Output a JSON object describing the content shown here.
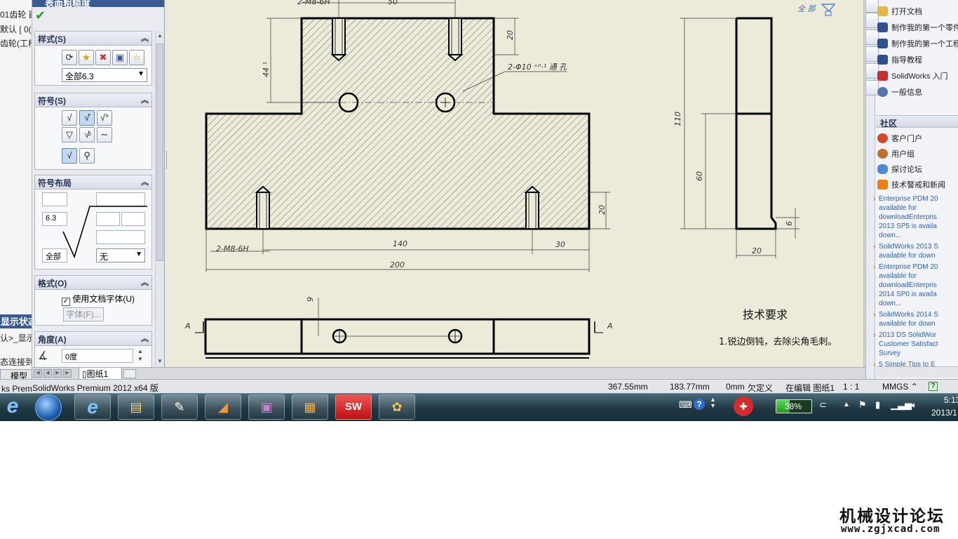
{
  "colors": {
    "accent": "#3a5a96",
    "sheet": "#ecebd9",
    "taskbar": "#1f3743",
    "link": "#2f63b6",
    "ok": "#2c9a2c"
  },
  "tree": {
    "rows": [
      "01齿轮 酉",
      "默认 [ 0(",
      "齿轮(工柄"
    ],
    "header": "显示状态",
    "rows2": [
      "认>_显示",
      "态连接到"
    ],
    "model_tab": "模型",
    "bottom_frag": "ks Premi"
  },
  "pm": {
    "title": "表面粗糙度",
    "groups": {
      "style": {
        "title": "样式(S)",
        "preset": "全部6.3"
      },
      "symbol": {
        "title": "符号(S)"
      },
      "layout": {
        "title": "符号布局",
        "value": "6.3",
        "all_label": "全部",
        "none_option": "无"
      },
      "format": {
        "title": "格式(O)",
        "use_doc_font": "使用文档字体(U)",
        "font_btn": "字体(F)..."
      },
      "angle": {
        "title": "角度(A)",
        "value": "0度"
      }
    }
  },
  "drawing": {
    "view_label": "全 部",
    "dims": {
      "top_thread": "2-M8-6H",
      "top_50": "50",
      "h20_top": "20",
      "h44": "44 ¹",
      "hole_note": "2-Φ10 ⁺⁰·¹ 通 孔",
      "h20_bot": "20",
      "bot_thread": "2-M8-6H",
      "w140": "140",
      "w30": "30",
      "w200": "200",
      "h110": "110",
      "h60": "60",
      "h6": "6",
      "w20": "20",
      "dim9": "9",
      "sec_a": "A"
    },
    "tech_title": "技术要求",
    "tech_item": "1.锐边倒钝，去除尖角毛刺。"
  },
  "sheet_tab": "图纸1",
  "status": {
    "product": "SolidWorks Premium 2012 x64 版",
    "x": "367.55mm",
    "y": "183.77mm",
    "z": "0mm",
    "defined": "欠定义",
    "editing": "在编辑 图纸1",
    "scale": "1 : 1",
    "units": "MMGS ⌃",
    "help": "?"
  },
  "task_pane": {
    "links": [
      {
        "label": "打开文档",
        "icon": "folder-icon",
        "color": "#e8b640"
      },
      {
        "label": "制作我的第一个零件",
        "icon": "graduation-cap-icon",
        "color": "#2f4f8f"
      },
      {
        "label": "制作我的第一个工程图",
        "icon": "graduation-cap-icon",
        "color": "#2f4f8f"
      },
      {
        "label": "指导教程",
        "icon": "graduation-cap-icon",
        "color": "#2f4f8f"
      },
      {
        "label": "SolidWorks 入门",
        "icon": "solidworks-icon",
        "color": "#c9302c"
      },
      {
        "label": "一般信息",
        "icon": "info-icon",
        "color": "#5577aa"
      }
    ],
    "community_title": "社区",
    "community": [
      {
        "label": "客户门户",
        "icon": "portal-icon",
        "color": "#d04a2a"
      },
      {
        "label": "用户组",
        "icon": "user-group-icon",
        "color": "#c07030"
      },
      {
        "label": "探讨论坛",
        "icon": "forum-icon",
        "color": "#4a8ad0"
      },
      {
        "label": "技术警戒和新闻",
        "icon": "rss-icon",
        "color": "#ef7d16"
      }
    ],
    "news": [
      "Enterprise PDM 20\navailable for\ndownloadEnterpris\n2013 SP5 is availa\ndown...",
      "SolidWorks 2013 S\navailable for down",
      "Enterprise PDM 20\navailable for\ndownloadEnterpris\n2014 SP0 is availa\ndown...",
      "SolidWorks 2014 S\navailable for down",
      "2013 DS SolidWor\nCustomer Satisfact\nSurvey",
      "5 Simple Tips to E"
    ]
  },
  "taskbar": {
    "battery": "38%",
    "battery_level": 0.38,
    "time": "5:13",
    "date": "2013/1"
  },
  "watermark": {
    "title": "机械设计论坛",
    "url": "www.zgjxcad.com"
  }
}
